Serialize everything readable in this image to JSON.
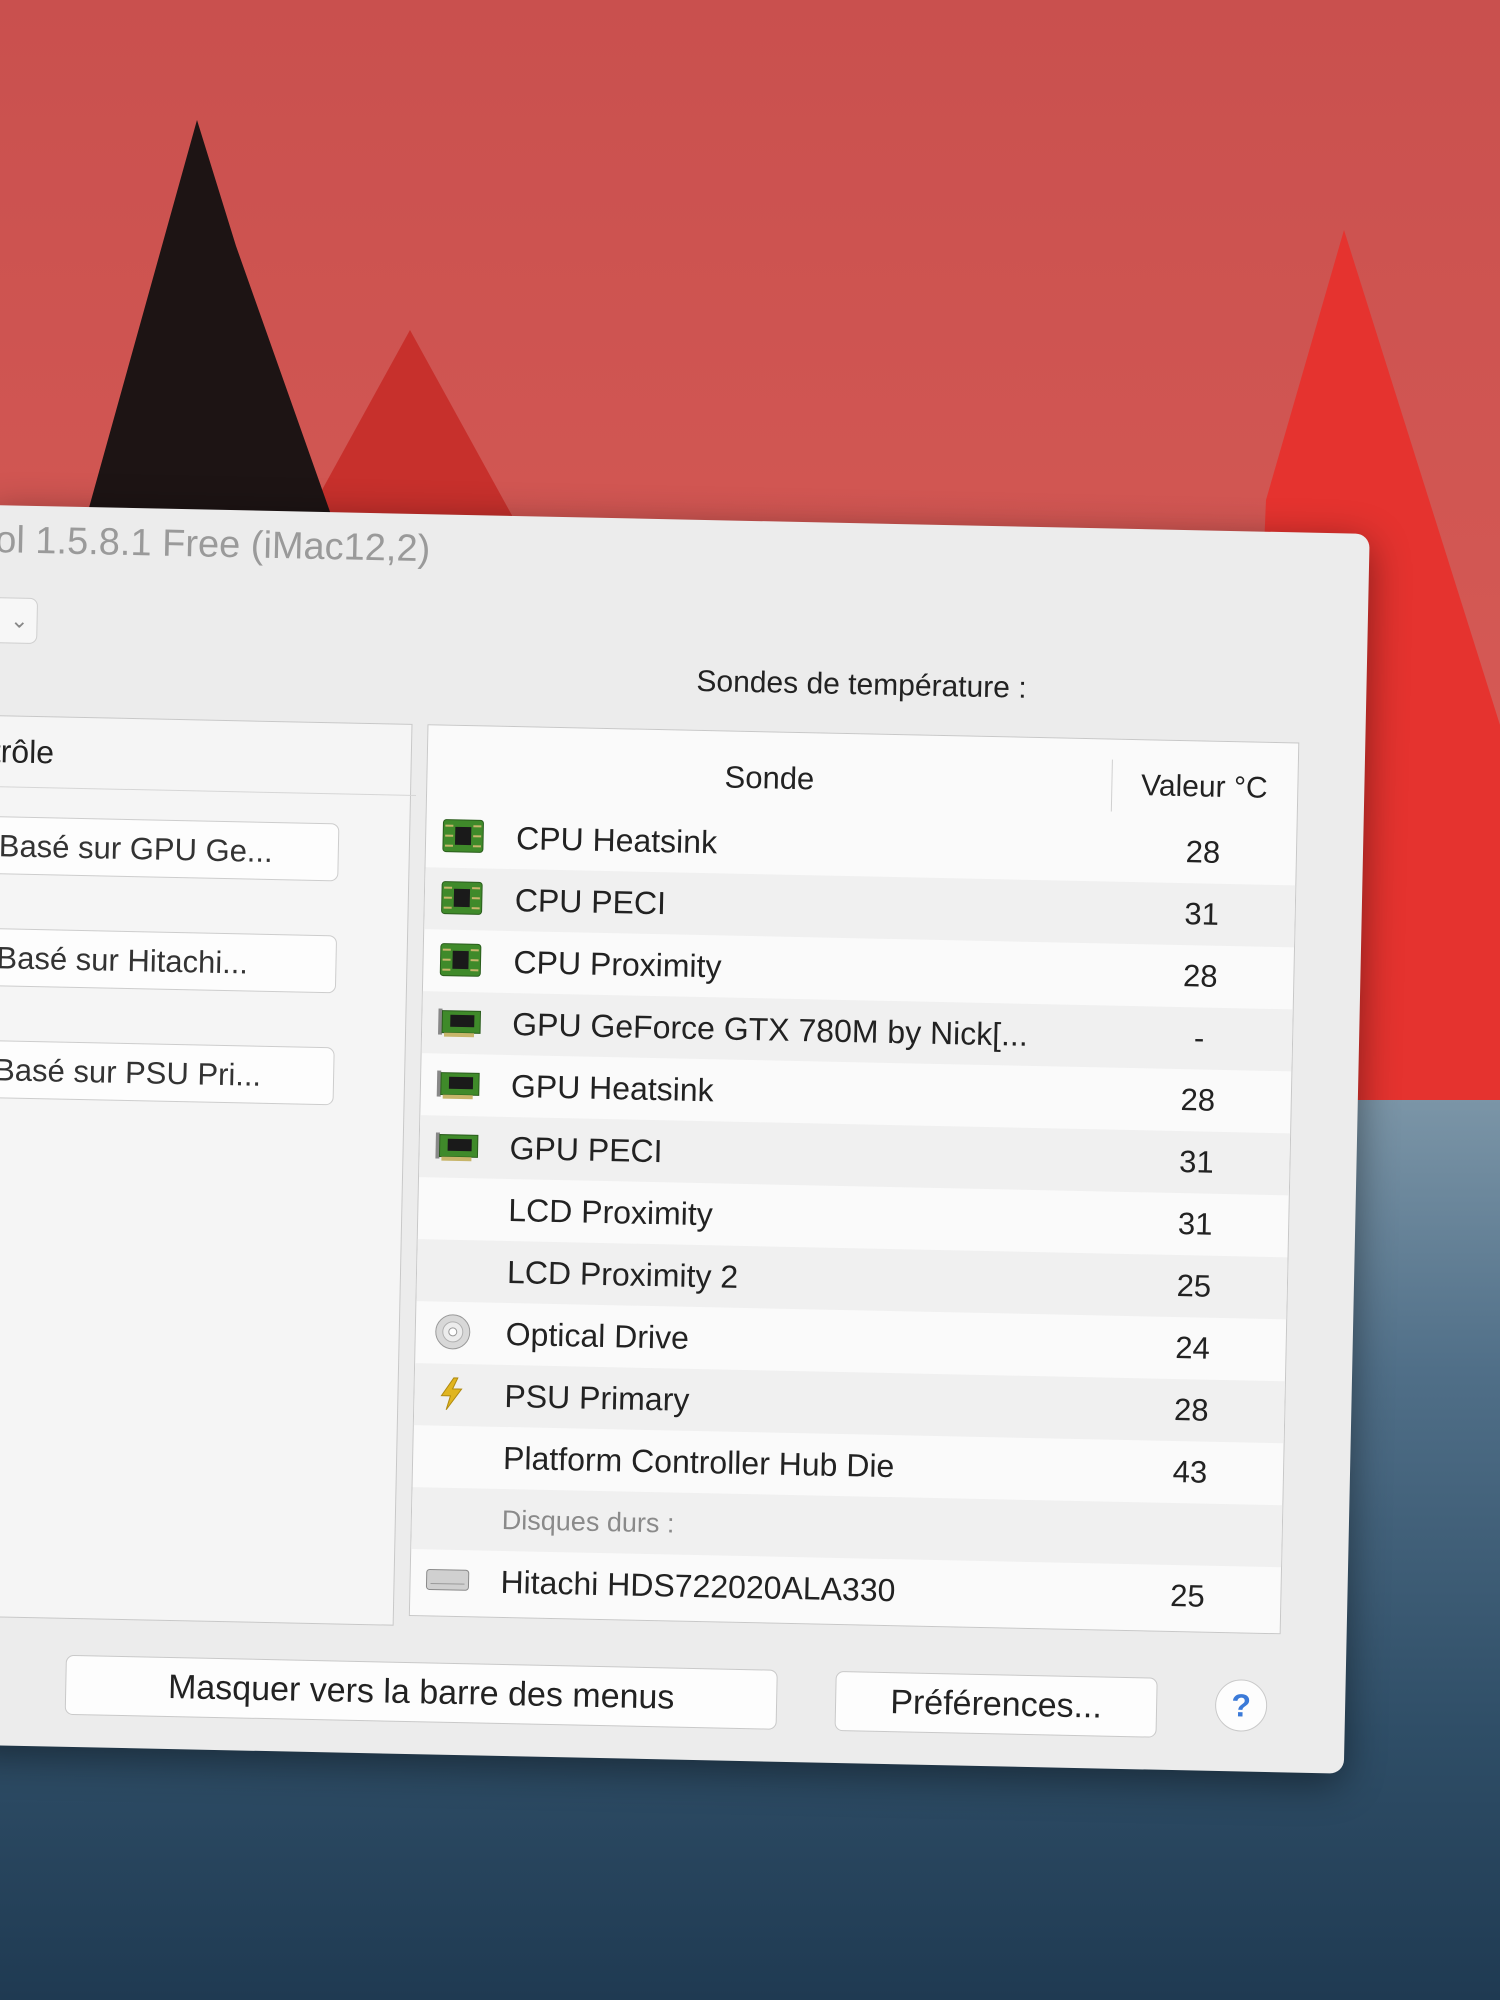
{
  "window": {
    "title": "ol 1.5.8.1 Free (iMac12,2)",
    "dropdown_glyph": "⌄"
  },
  "left_panel": {
    "header": "trôle",
    "buttons": [
      "Basé sur GPU Ge...",
      "Basé sur Hitachi...",
      "Basé sur PSU Pri..."
    ]
  },
  "sensors": {
    "section_label": "Sondes de température :",
    "columns": {
      "sonde": "Sonde",
      "valeur": "Valeur °C"
    },
    "rows": [
      {
        "icon": "cpu-chip-icon",
        "name": "CPU Heatsink",
        "value": "28"
      },
      {
        "icon": "cpu-chip-icon",
        "name": "CPU PECI",
        "value": "31"
      },
      {
        "icon": "cpu-chip-icon",
        "name": "CPU Proximity",
        "value": "28"
      },
      {
        "icon": "gpu-card-icon",
        "name": "GPU GeForce GTX 780M by Nick[...",
        "value": "-"
      },
      {
        "icon": "gpu-card-icon",
        "name": "GPU Heatsink",
        "value": "28"
      },
      {
        "icon": "gpu-card-icon",
        "name": "GPU PECI",
        "value": "31"
      },
      {
        "icon": "",
        "name": "LCD Proximity",
        "value": "31"
      },
      {
        "icon": "",
        "name": "LCD Proximity 2",
        "value": "25"
      },
      {
        "icon": "optical-disc-icon",
        "name": "Optical Drive",
        "value": "24"
      },
      {
        "icon": "lightning-icon",
        "name": "PSU Primary",
        "value": "28"
      },
      {
        "icon": "",
        "name": "Platform Controller Hub Die",
        "value": "43"
      }
    ],
    "disks_label": "Disques durs :",
    "disks": [
      {
        "icon": "hard-drive-icon",
        "name": "Hitachi HDS722020ALA330",
        "value": "25"
      }
    ]
  },
  "footer": {
    "hide_button": "Masquer vers la barre des menus",
    "prefs_button": "Préférences...",
    "help_button": "?"
  },
  "colors": {
    "chip_green": "#3f8a2a",
    "accent_blue": "#3b7ad8",
    "bolt_yellow": "#e0b520"
  }
}
